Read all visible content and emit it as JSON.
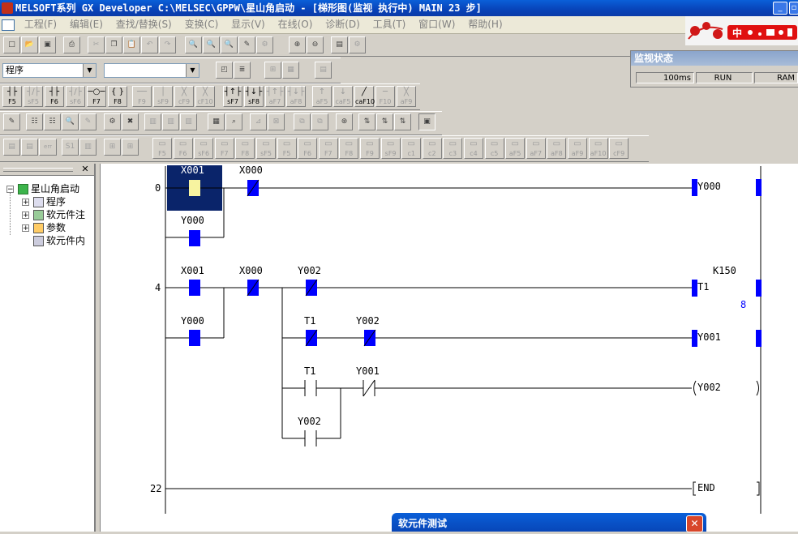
{
  "window": {
    "title": "MELSOFT系列 GX Developer C:\\MELSEC\\GPPW\\星山角启动 - [梯形图(监视 执行中)      MAIN    23 步]",
    "min_glyph": "_",
    "restore_glyph": "▫"
  },
  "menubar": {
    "items": [
      "工程(F)",
      "编辑(E)",
      "查找/替换(S)",
      "变换(C)",
      "显示(V)",
      "在线(O)",
      "诊断(D)",
      "工具(T)",
      "窗口(W)",
      "帮助(H)"
    ]
  },
  "toolbar": {
    "program_combo": "程序",
    "second_combo": ""
  },
  "ime": {
    "label": "中"
  },
  "fkeys_row1": [
    {
      "sym": "┤├",
      "label": "F5"
    },
    {
      "sym": "┤/├",
      "label": "sF5"
    },
    {
      "sym": "┤├",
      "label": "F6"
    },
    {
      "sym": "┤/├",
      "label": "sF6"
    },
    {
      "sym": "─○─",
      "label": "F7"
    },
    {
      "sym": "{ }",
      "label": "F8"
    },
    {
      "sym": "──",
      "label": "F9"
    },
    {
      "sym": "│",
      "label": "sF9"
    },
    {
      "sym": "╳",
      "label": "cF9"
    },
    {
      "sym": "╳",
      "label": "cF10"
    },
    {
      "sym": "┤↑├",
      "label": "sF7"
    },
    {
      "sym": "┤↓├",
      "label": "sF8"
    },
    {
      "sym": "┤↑├",
      "label": "aF7"
    },
    {
      "sym": "┤↓├",
      "label": "aF8"
    },
    {
      "sym": "↑",
      "label": "aF5"
    },
    {
      "sym": "↓",
      "label": "caF5"
    },
    {
      "sym": "╱",
      "label": "caF10"
    },
    {
      "sym": "─",
      "label": "F10"
    },
    {
      "sym": "╳",
      "label": "aF9"
    }
  ],
  "fkeys_row3": [
    "F5",
    "F6",
    "sF6",
    "F7",
    "F8",
    "sF5",
    "F5",
    "F6",
    "F7",
    "F8",
    "F9",
    "sF9",
    "c1",
    "c2",
    "c3",
    "c4",
    "c5",
    "aF5",
    "aF7",
    "aF8",
    "aF9",
    "aF10",
    "cF9"
  ],
  "monitor": {
    "title": "监视状态",
    "scan_time": "100ms",
    "state": "RUN",
    "memory": "RAM"
  },
  "tree": {
    "root": "星山角启动",
    "items": [
      "程序",
      "软元件注",
      "参数",
      "软元件内"
    ]
  },
  "ladder": {
    "steps": [
      "0",
      "4",
      "22"
    ],
    "rung0": {
      "c1": "X001",
      "c2": "X000",
      "branch": "Y000",
      "coil": "Y000"
    },
    "rung4": {
      "c1": "X001",
      "c2": "X000",
      "c3": "Y002",
      "branch": "Y000",
      "coil_t1": "T1",
      "k": "K150",
      "timer_value": "8",
      "b1": "T1",
      "b2": "Y002",
      "coil_y001": "Y001",
      "c_t1": "T1",
      "c_y001": "Y001",
      "coil_y002": "Y002",
      "branch_y002": "Y002"
    },
    "end": "END"
  },
  "dialog": {
    "title": "软元件测试",
    "close_glyph": "✕"
  },
  "colors": {
    "active": "#0000ff",
    "cursor": "#0a246a",
    "cursor_fill": "#f7f3a0"
  }
}
